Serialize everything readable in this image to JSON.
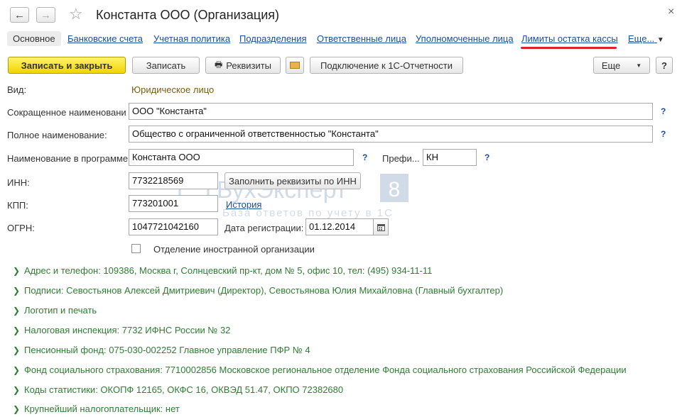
{
  "window": {
    "title": "Константа ООО (Организация)",
    "back_icon": "arrow-left-icon",
    "forward_icon": "arrow-right-icon",
    "favorite_icon": "star-icon",
    "close_icon": "close-icon"
  },
  "tabs": [
    {
      "label": "Основное",
      "active": true
    },
    {
      "label": "Банковские счета"
    },
    {
      "label": "Учетная политика"
    },
    {
      "label": "Подразделения"
    },
    {
      "label": "Ответственные лица"
    },
    {
      "label": "Уполномоченные лица"
    },
    {
      "label": "Лимиты остатка кассы",
      "highlighted": true
    },
    {
      "label": "Еще..."
    }
  ],
  "toolbar": {
    "save_close": "Записать и закрыть",
    "save": "Записать",
    "requisites": "Реквизиты",
    "connect": "Подключение к 1С-Отчетности",
    "more": "Еще",
    "help": "?"
  },
  "form": {
    "vid_label": "Вид:",
    "vid_value": "Юридическое лицо",
    "short_name_label": "Сокращенное наименовани",
    "short_name_value": "ООО \"Константа\"",
    "full_name_label": "Полное наименование:",
    "full_name_value": "Общество с ограниченной ответственностью \"Константа\"",
    "prog_name_label": "Наименование в программе:",
    "prog_name_value": "Константа ООО",
    "prefix_label": "Префи...",
    "prefix_value": "КН",
    "inn_label": "ИНН:",
    "inn_value": "7732218569",
    "fill_by_inn": "Заполнить реквизиты по ИНН",
    "kpp_label": "КПП:",
    "kpp_value": "773201001",
    "history": "История",
    "ogrn_label": "ОГРН:",
    "ogrn_value": "1047721042160",
    "reg_date_label": "Дата регистрации:",
    "reg_date_value": "01.12.2014",
    "foreign_label": "Отделение иностранной организации",
    "foreign_checked": false,
    "help_mark": "?"
  },
  "groups": [
    "Адрес и телефон: 109386, Москва г, Солнцевский пр-кт, дом № 5, офис 10, тел: (495) 934-11-11",
    "Подписи: Севостьянов Алексей Дмитриевич (Директор), Севостьянова Юлия Михайловна (Главный бухгалтер)",
    "Логотип и печать",
    "Налоговая инспекция: 7732 ИФНС России № 32",
    "Пенсионный фонд: 075-030-002252 Главное управление ПФР № 4",
    "Фонд социального страхования: 7710002856 Московское региональное отделение Фонда социального страхования Российской Федерации",
    "Коды статистики: ОКОПФ 12165, ОКФС 16, ОКВЭД 51.47, ОКПО 72382680",
    "Крупнейший налогоплательщик: нет"
  ],
  "watermark": {
    "brand": "БухЭксперт",
    "number": "8",
    "subtitle": "База ответов по учету в 1С"
  },
  "colors": {
    "primary_button": "#f2d400",
    "link": "#1a4d9b",
    "group_text": "#2e7d32",
    "tab_highlight": "#d9252a"
  }
}
